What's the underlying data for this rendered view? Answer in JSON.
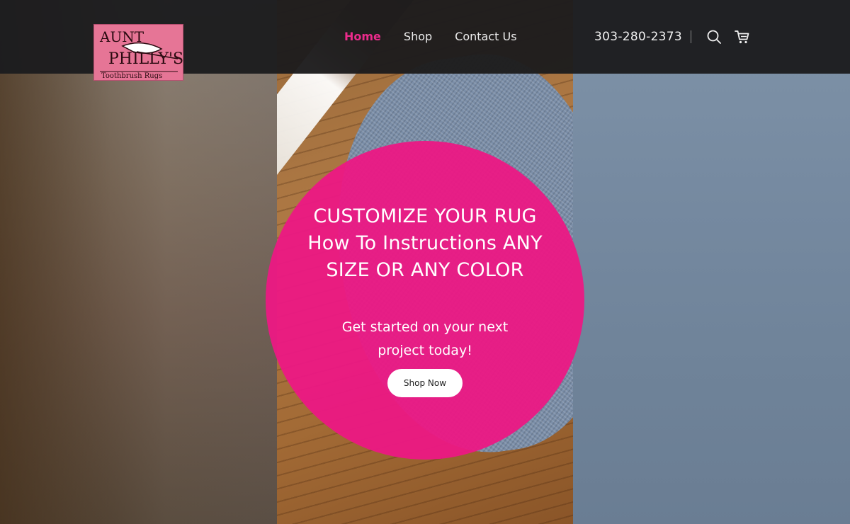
{
  "brand": {
    "logo_line1": "AUNT",
    "logo_line2": "PHILLY'S",
    "logo_line3": "Toothbrush Rugs",
    "logo_color": "#e67596"
  },
  "nav": {
    "items": [
      {
        "label": "Home",
        "active": true
      },
      {
        "label": "Shop",
        "active": false
      },
      {
        "label": "Contact Us",
        "active": false
      }
    ],
    "active_color": "#ec2b8c"
  },
  "header": {
    "phone": "303-280-2373",
    "search_icon": "search-icon",
    "cart_icon": "cart-icon"
  },
  "hero": {
    "title": "CUSTOMIZE YOUR RUG How To Instructions ANY SIZE OR ANY COLOR",
    "subtitle": "Get started on your next project today!",
    "cta_label": "Shop Now",
    "circle_color": "#ec1884"
  }
}
